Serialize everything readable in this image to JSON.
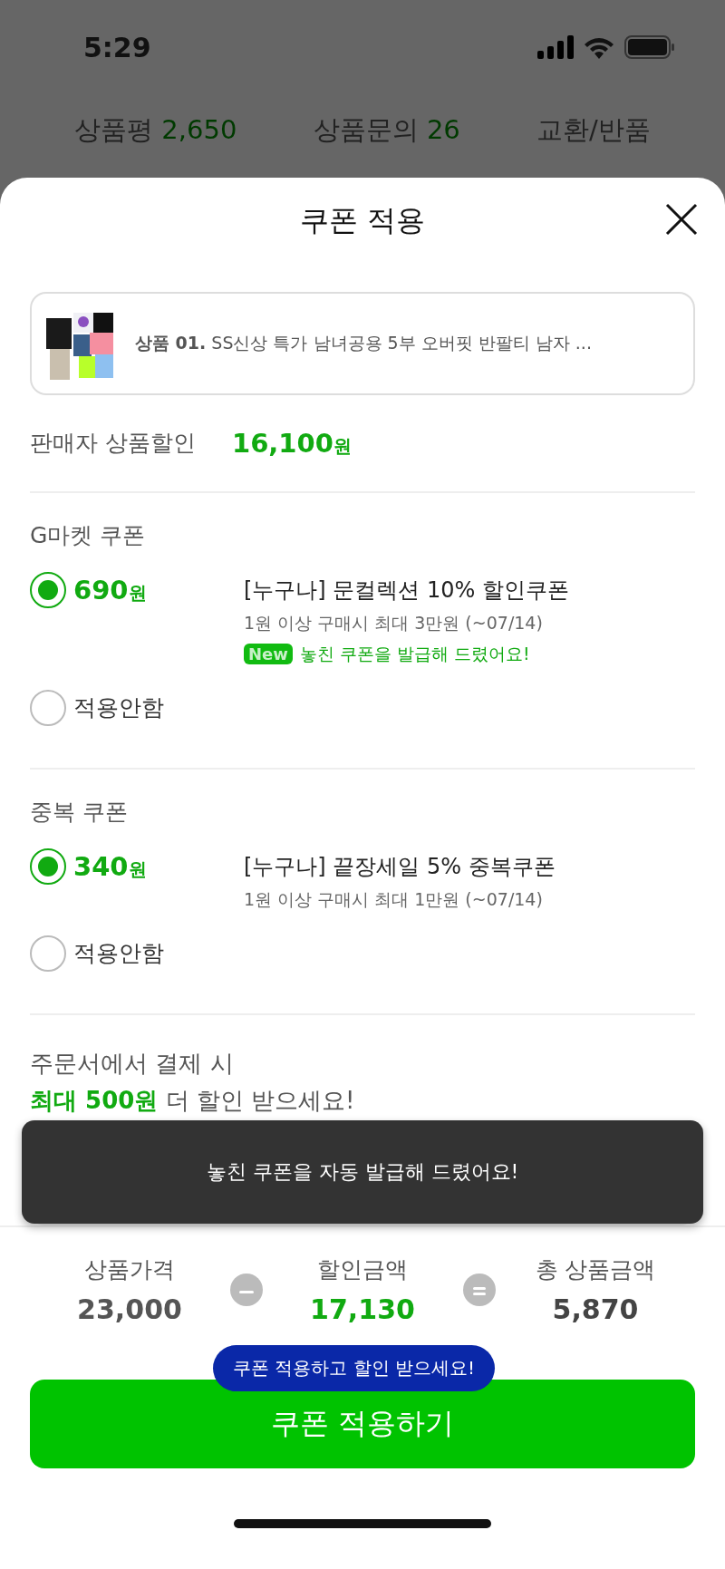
{
  "status_bar": {
    "time": "5:29"
  },
  "background_tabs": [
    {
      "label": "상품평",
      "count": "2,650"
    },
    {
      "label": "상품문의",
      "count": "26"
    },
    {
      "label": "교환/반품"
    }
  ],
  "sheet": {
    "title": "쿠폰 적용",
    "product": {
      "kind": "picture",
      "label": "상품 01.",
      "name": "SS신상 특가 남녀공용 5부 오버핏 반팔티 남자 ..."
    },
    "seller_discount": {
      "label": "판매자 상품할인",
      "amount": "16,100",
      "unit": "원"
    },
    "coupon_groups": [
      {
        "title": "G마켓 쿠폰",
        "options": [
          {
            "kind": "coupon",
            "selected": true,
            "amount": "690",
            "unit": "원",
            "name": "[누구나] 문컬렉션 10% 할인쿠폰",
            "condition": "1원 이상 구매시 최대 3만원 (~07/14)",
            "badge": "New",
            "note": "놓친 쿠폰을 발급해 드렸어요!"
          },
          {
            "kind": "none",
            "selected": false,
            "label": "적용안함"
          }
        ]
      },
      {
        "title": "중복 쿠폰",
        "options": [
          {
            "kind": "coupon",
            "selected": true,
            "amount": "340",
            "unit": "원",
            "name": "[누구나] 끝장세일 5% 중복쿠폰",
            "condition": "1원 이상 구매시 최대 1만원 (~07/14)"
          },
          {
            "kind": "none",
            "selected": false,
            "label": "적용안함"
          }
        ]
      }
    ],
    "promo": {
      "line1": "주문서에서 결제 시",
      "line2": "**최대 500원** 더 할인 받으세요!"
    },
    "toast": "놓친 쿠폰을 자동 발급해 드렸어요!",
    "summary": [
      {
        "label": "상품가격",
        "value": "23,000",
        "color": "#555555"
      },
      {
        "kind": "minus"
      },
      {
        "label": "할인금액",
        "value": "17,130",
        "color": "#11aa11"
      },
      {
        "kind": "equals"
      },
      {
        "label": "총 상품금액",
        "value": "5,870",
        "color": "#444444"
      }
    ],
    "tooltip": "쿠폰 적용하고 할인 받으세요!",
    "apply_button": "쿠폰 적용하기"
  }
}
